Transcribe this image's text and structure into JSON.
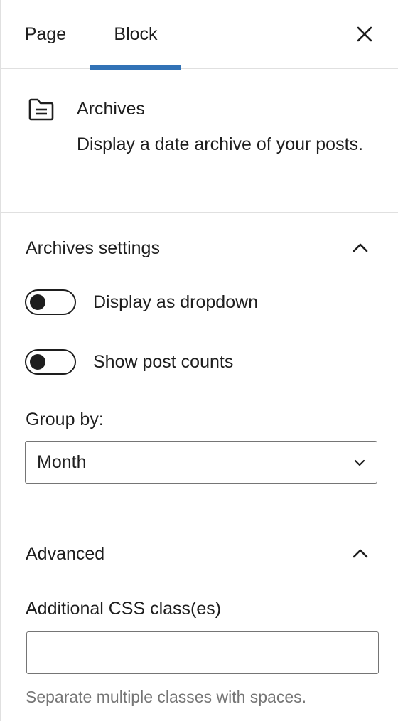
{
  "tabs": {
    "page_label": "Page",
    "block_label": "Block",
    "active": "Block"
  },
  "block": {
    "icon": "archive-icon",
    "title": "Archives",
    "description": "Display a date archive of your posts."
  },
  "settings": {
    "title": "Archives settings",
    "toggles": [
      {
        "label": "Display as dropdown",
        "checked": false
      },
      {
        "label": "Show post counts",
        "checked": false
      }
    ],
    "group_by_label": "Group by:",
    "group_by_value": "Month"
  },
  "advanced": {
    "title": "Advanced",
    "css_label": "Additional CSS class(es)",
    "css_value": "",
    "css_help": "Separate multiple classes with spaces."
  },
  "colors": {
    "accent": "#3172b6",
    "text": "#1e1e1e",
    "muted": "#757575",
    "divider": "#e0e0e0"
  }
}
